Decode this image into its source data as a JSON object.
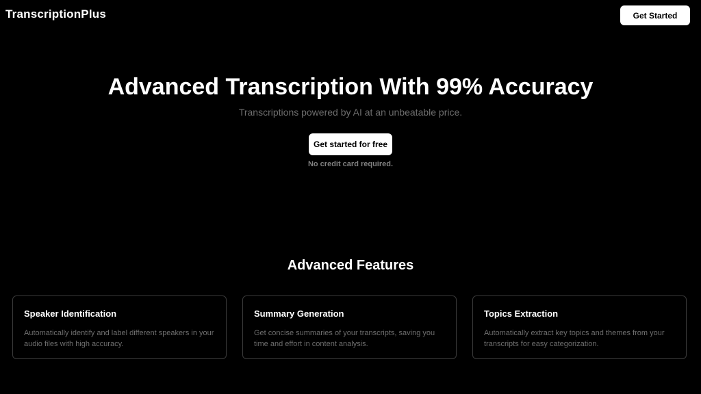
{
  "header": {
    "brand": "TranscriptionPlus",
    "cta_label": "Get Started"
  },
  "hero": {
    "title": "Advanced Transcription With 99% Accuracy",
    "subtitle": "Transcriptions powered by AI at an unbeatable price.",
    "cta_label": "Get started for free",
    "note": "No credit card required."
  },
  "features": {
    "title": "Advanced Features",
    "items": [
      {
        "title": "Speaker Identification",
        "description": "Automatically identify and label different speakers in your audio files with high accuracy."
      },
      {
        "title": "Summary Generation",
        "description": "Get concise summaries of your transcripts, saving you time and effort in content analysis."
      },
      {
        "title": "Topics Extraction",
        "description": "Automatically extract key topics and themes from your transcripts for easy categorization."
      }
    ]
  },
  "colors": {
    "background": "#000000",
    "text": "#ffffff",
    "muted": "#6e6e6e",
    "card_border": "#3a3a3a",
    "button_bg": "#ffffff",
    "button_text": "#000000"
  }
}
